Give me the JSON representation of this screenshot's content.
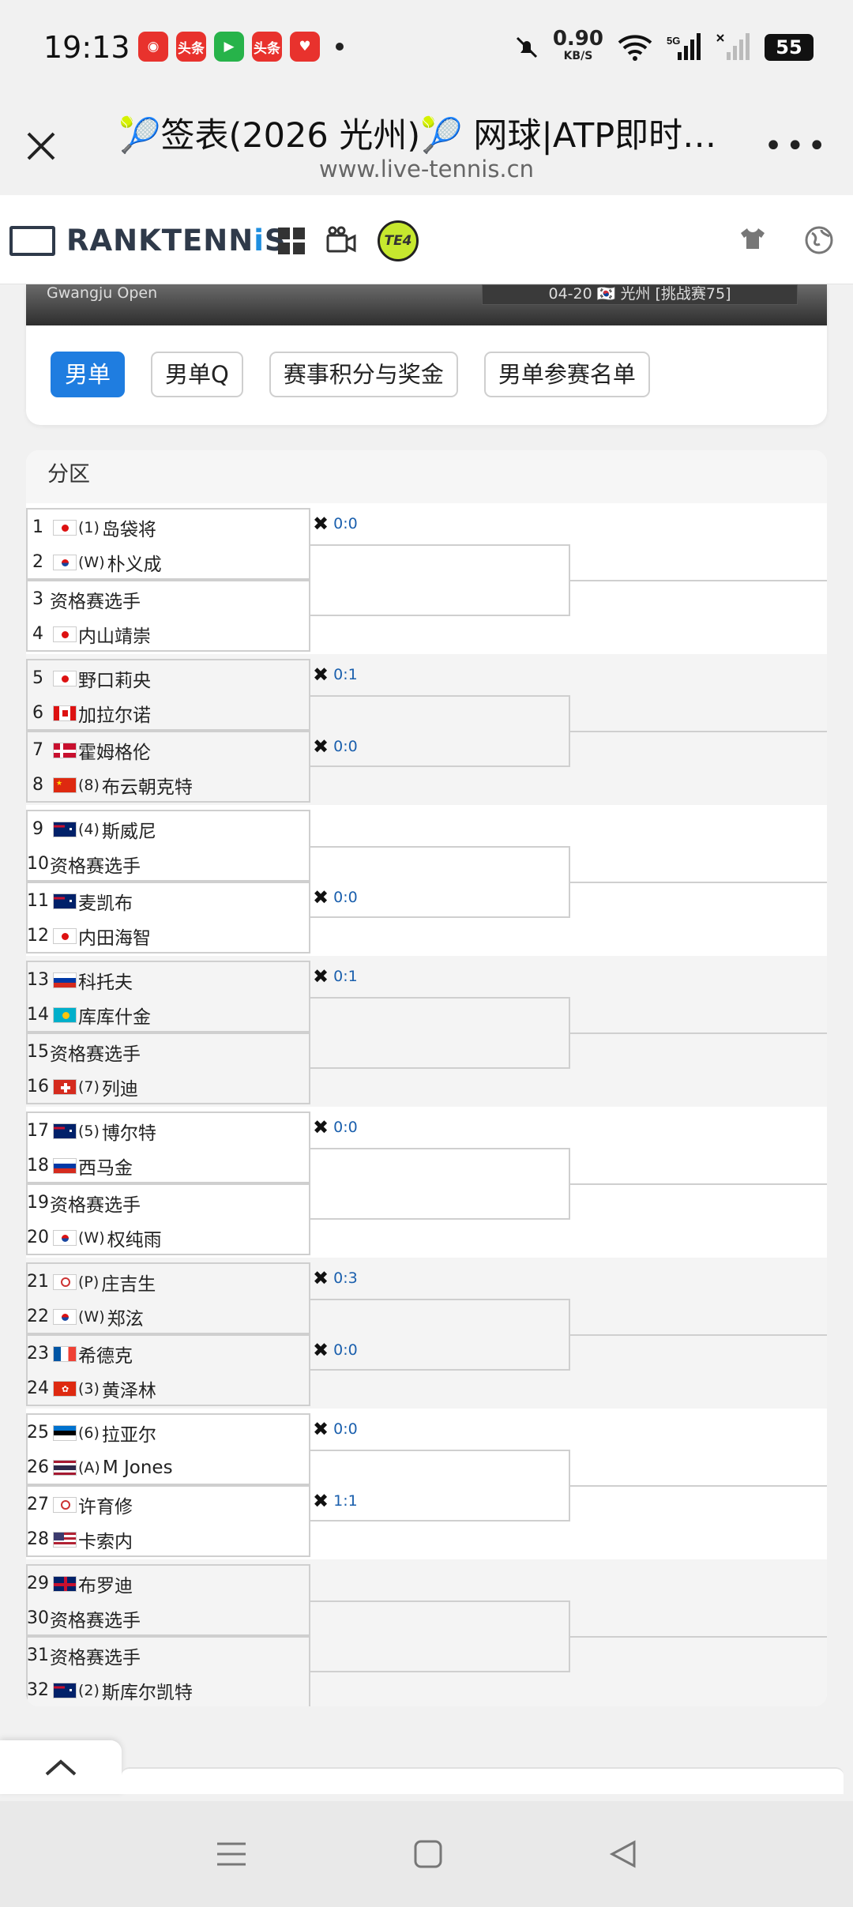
{
  "status": {
    "time": "19:13",
    "speed": "0.90",
    "speed_unit": "KB/S",
    "battery": "55",
    "notif_labels": [
      "头条",
      "头条"
    ]
  },
  "titlebar": {
    "title": "🎾签表(2026 光州)🎾 网球|ATP即时…",
    "url": "www.live-tennis.cn"
  },
  "site": {
    "logo_a": "RANKTENN",
    "logo_b": "i",
    "logo_c": "S",
    "badge": "TE4"
  },
  "banner": {
    "left": "Gwangju Open",
    "right": "04-20 🇰🇷 光州 [挑战赛75]"
  },
  "tabs": [
    {
      "label": "男单",
      "active": true
    },
    {
      "label": "男单Q",
      "active": false
    },
    {
      "label": "赛事积分与奖金",
      "active": false
    },
    {
      "label": "男单参赛名单",
      "active": false
    }
  ],
  "draw": {
    "section_title": "分区",
    "blocks": [
      {
        "players": [
          {
            "num": "1",
            "flag": "jp",
            "seed": "(1)",
            "name": "岛袋将"
          },
          {
            "num": "2",
            "flag": "kr",
            "seed": "(W)",
            "name": "朴义成"
          },
          {
            "num": "3",
            "flag": "",
            "seed": "",
            "name": "资格赛选手"
          },
          {
            "num": "4",
            "flag": "jp",
            "seed": "",
            "name": "内山靖崇"
          }
        ],
        "scores": [
          "0:0",
          ""
        ]
      },
      {
        "players": [
          {
            "num": "5",
            "flag": "jp",
            "seed": "",
            "name": "野口莉央"
          },
          {
            "num": "6",
            "flag": "ca",
            "seed": "",
            "name": "加拉尔诺"
          },
          {
            "num": "7",
            "flag": "dk",
            "seed": "",
            "name": "霍姆格伦"
          },
          {
            "num": "8",
            "flag": "cn",
            "seed": "(8)",
            "name": "布云朝克特"
          }
        ],
        "scores": [
          "0:1",
          "0:0"
        ]
      },
      {
        "players": [
          {
            "num": "9",
            "flag": "au",
            "seed": "(4)",
            "name": "斯威尼"
          },
          {
            "num": "10",
            "flag": "",
            "seed": "",
            "name": "资格赛选手"
          },
          {
            "num": "11",
            "flag": "au",
            "seed": "",
            "name": "麦凯布"
          },
          {
            "num": "12",
            "flag": "jp",
            "seed": "",
            "name": "内田海智"
          }
        ],
        "scores": [
          "",
          "0:0"
        ]
      },
      {
        "players": [
          {
            "num": "13",
            "flag": "ru",
            "seed": "",
            "name": "科托夫"
          },
          {
            "num": "14",
            "flag": "kz",
            "seed": "",
            "name": "库库什金"
          },
          {
            "num": "15",
            "flag": "",
            "seed": "",
            "name": "资格赛选手"
          },
          {
            "num": "16",
            "flag": "ch",
            "seed": "(7)",
            "name": "列迪"
          }
        ],
        "scores": [
          "0:1",
          ""
        ]
      },
      {
        "players": [
          {
            "num": "17",
            "flag": "au",
            "seed": "(5)",
            "name": "博尔特"
          },
          {
            "num": "18",
            "flag": "ru",
            "seed": "",
            "name": "西马金"
          },
          {
            "num": "19",
            "flag": "",
            "seed": "",
            "name": "资格赛选手"
          },
          {
            "num": "20",
            "flag": "kr",
            "seed": "(W)",
            "name": "权纯雨"
          }
        ],
        "scores": [
          "0:0",
          ""
        ]
      },
      {
        "players": [
          {
            "num": "21",
            "flag": "tw",
            "seed": "(P)",
            "name": "庄吉生"
          },
          {
            "num": "22",
            "flag": "kr",
            "seed": "(W)",
            "name": "郑泫"
          },
          {
            "num": "23",
            "flag": "fr",
            "seed": "",
            "name": "希德克"
          },
          {
            "num": "24",
            "flag": "hk",
            "seed": "(3)",
            "name": "黄泽林"
          }
        ],
        "scores": [
          "0:3",
          "0:0"
        ]
      },
      {
        "players": [
          {
            "num": "25",
            "flag": "ee",
            "seed": "(6)",
            "name": "拉亚尔"
          },
          {
            "num": "26",
            "flag": "th",
            "seed": "(A)",
            "name": "M Jones"
          },
          {
            "num": "27",
            "flag": "tw",
            "seed": "",
            "name": "许育修"
          },
          {
            "num": "28",
            "flag": "us",
            "seed": "",
            "name": "卡索内"
          }
        ],
        "scores": [
          "0:0",
          "1:1"
        ]
      },
      {
        "players": [
          {
            "num": "29",
            "flag": "gb",
            "seed": "",
            "name": "布罗迪"
          },
          {
            "num": "30",
            "flag": "",
            "seed": "",
            "name": "资格赛选手"
          },
          {
            "num": "31",
            "flag": "",
            "seed": "",
            "name": "资格赛选手"
          },
          {
            "num": "32",
            "flag": "au",
            "seed": "(2)",
            "name": "斯库尔凯特"
          }
        ],
        "scores": [
          "",
          ""
        ]
      }
    ]
  },
  "colors": {
    "accent": "#1f7de0",
    "score": "#1a5fad",
    "brand": "#2f3a4a",
    "te4": "#c6e82e"
  }
}
